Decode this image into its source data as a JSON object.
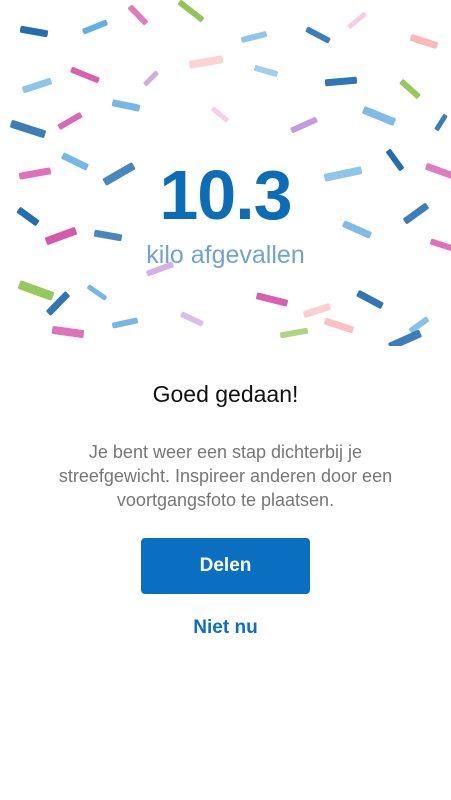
{
  "hero": {
    "amount": "10.3",
    "unit": "kilo afgevallen"
  },
  "content": {
    "headline": "Goed gedaan!",
    "message": "Je bent weer een stap dichterbij je streefgewicht. Inspireer anderen door een voortgangsfoto te plaatsen.",
    "share_label": "Delen",
    "not_now_label": "Niet nu"
  },
  "theme": {
    "primary_blue": "#0a6fc0",
    "light_blue": "#6ea3d3",
    "confetti_colors": [
      "#0b5ea8",
      "#53a6df",
      "#d44fa8",
      "#8bc34a",
      "#f1b6d8",
      "#b88bd9",
      "#f7a7a7"
    ]
  }
}
